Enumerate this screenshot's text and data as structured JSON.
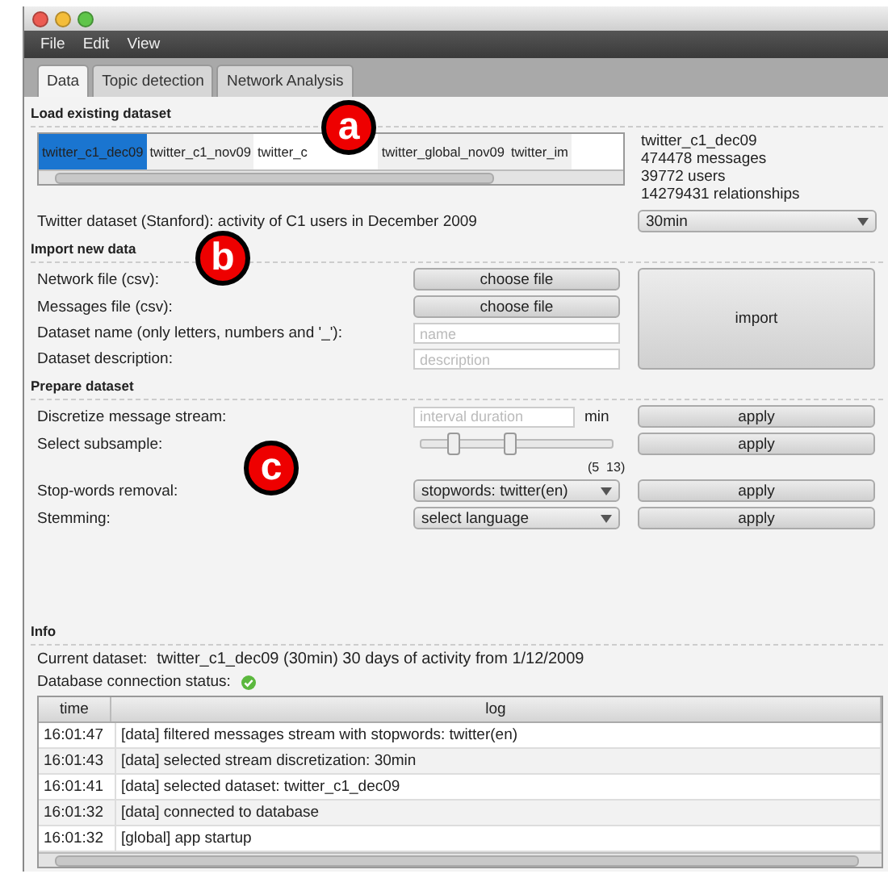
{
  "menu": [
    "File",
    "Edit",
    "View"
  ],
  "tabs": [
    {
      "label": "Data",
      "selected": true
    },
    {
      "label": "Topic detection",
      "selected": false
    },
    {
      "label": "Network Analysis",
      "selected": false
    }
  ],
  "load": {
    "heading": "Load existing dataset",
    "datasets": [
      {
        "label": "twitter_c1_dec09",
        "selected": true
      },
      {
        "label": "twitter_c1_nov09",
        "selected": false
      },
      {
        "label": "twitter_c",
        "selected": false
      },
      {
        "label": "twitter_global_nov09",
        "selected": false
      },
      {
        "label": "twitter_im",
        "selected": false
      }
    ],
    "details": [
      "twitter_c1_dec09",
      "474478 messages",
      "39772 users",
      "14279431 relationships"
    ],
    "description": "Twitter dataset (Stanford): activity of C1 users in December 2009",
    "interval": "30min"
  },
  "import": {
    "heading": "Import new data",
    "rows": [
      {
        "kind": "file",
        "label": "Network file (csv):",
        "button": "choose file"
      },
      {
        "kind": "file",
        "label": "Messages file (csv):",
        "button": "choose file"
      },
      {
        "kind": "text",
        "label": "Dataset name (only letters, numbers and '_'):",
        "placeholder": "name"
      },
      {
        "kind": "text",
        "label": "Dataset description:",
        "placeholder": "description"
      }
    ],
    "button": "import"
  },
  "prepare": {
    "heading": "Prepare dataset",
    "rows": [
      {
        "kind": "input",
        "label": "Discretize message stream:",
        "placeholder": "interval duration",
        "unit": "min",
        "button": "apply"
      },
      {
        "kind": "range",
        "label": "Select subsample:",
        "thumbs": [
          {
            "level": 0.16
          },
          {
            "level": 0.46
          }
        ],
        "reading": "(5  13)",
        "button": "apply"
      },
      {
        "kind": "select",
        "label": "Stop-words removal:",
        "value": "stopwords: twitter(en)",
        "button": "apply"
      },
      {
        "kind": "select",
        "label": "Stemming:",
        "value": "select language",
        "button": "apply"
      }
    ]
  },
  "info": {
    "heading": "Info",
    "current_label": "Current dataset:",
    "current_value": "twitter_c1_dec09 (30min) 30 days of activity from 1/12/2009",
    "status_label": "Database connection status:",
    "connected": true,
    "columns": [
      "time",
      "log"
    ],
    "rows": [
      [
        "16:01:47",
        "[data] filtered messages stream with stopwords: twitter(en)"
      ],
      [
        "16:01:43",
        "[data] selected stream discretization: 30min"
      ],
      [
        "16:01:41",
        "[data] selected dataset: twitter_c1_dec09"
      ],
      [
        "16:01:32",
        "[data] connected to database"
      ],
      [
        "16:01:32",
        "[global] app startup"
      ]
    ]
  },
  "callouts": [
    "a",
    "b",
    "c"
  ]
}
